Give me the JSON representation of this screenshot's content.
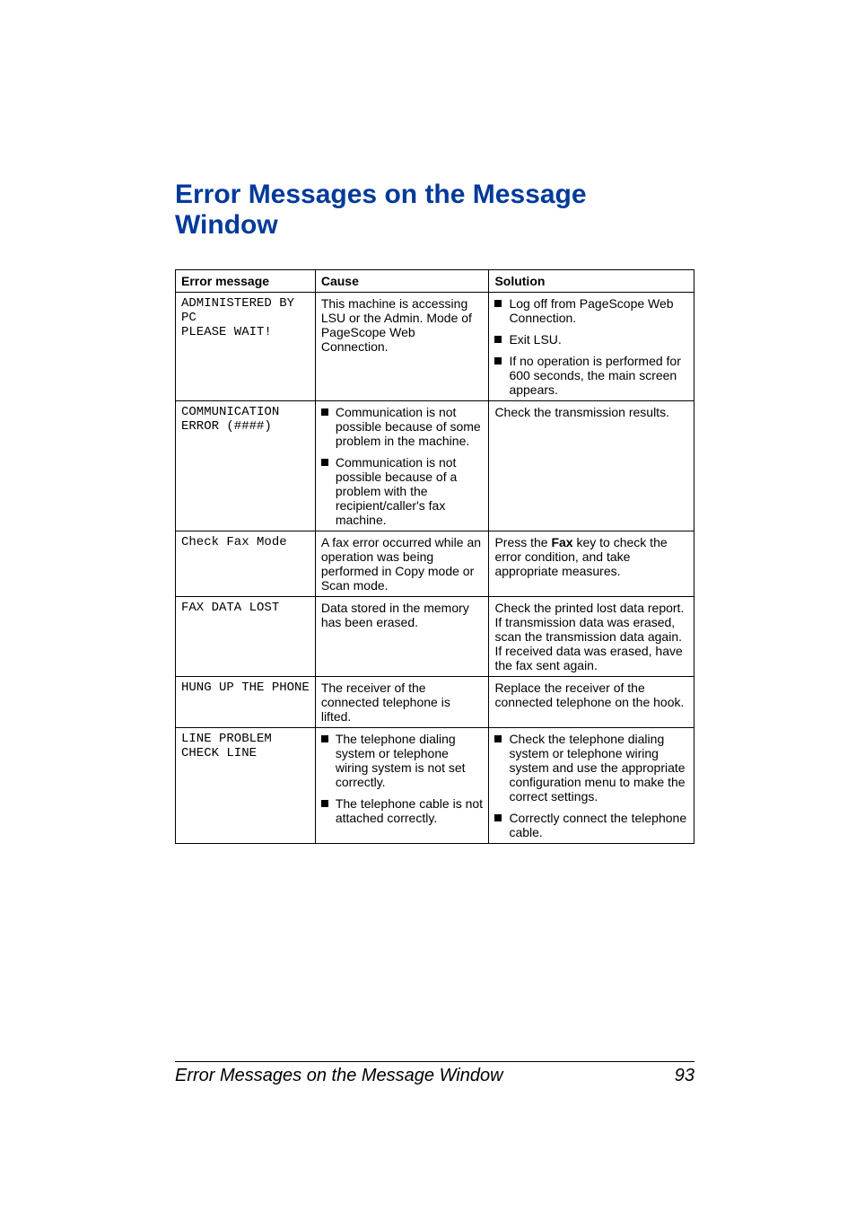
{
  "title": "Error Messages on the Message Window",
  "columns": {
    "c1": "Error message",
    "c2": "Cause",
    "c3": "Solution"
  },
  "rows": {
    "r1": {
      "msg": "ADMINISTERED BY\nPC\nPLEASE WAIT!",
      "cause": "This machine is accessing LSU or the Admin. Mode of PageScope Web Connection.",
      "sol": {
        "b1": "Log off from PageScope Web Connection.",
        "b2": "Exit LSU.",
        "b3": "If no operation is performed for 600 seconds, the main screen appears."
      }
    },
    "r2": {
      "msg": "COMMUNICATION\nERROR (####)",
      "cause": {
        "b1": "Communication is not possible because of some problem in the machine.",
        "b2": "Communication is not possible because of a problem with the recipient/caller's fax machine."
      },
      "sol": "Check the transmission results."
    },
    "r3": {
      "msg": "Check Fax Mode",
      "cause": "A fax error occurred while an operation was being performed in Copy mode or Scan mode.",
      "sol_prefix": "Press the ",
      "sol_bold": "Fax",
      "sol_suffix": " key to check the error condition, and take appropriate measures."
    },
    "r4": {
      "msg": "FAX DATA LOST",
      "cause": "Data stored in the memory has been erased.",
      "sol": "Check the printed lost data report. If transmission data was erased, scan the transmission data again. If received data was erased, have the fax sent again."
    },
    "r5": {
      "msg": "HUNG UP THE PHONE",
      "cause": "The receiver of the connected telephone is lifted.",
      "sol": "Replace the receiver of the connected telephone on the hook."
    },
    "r6": {
      "msg": "LINE PROBLEM\nCHECK LINE",
      "cause": {
        "b1": "The telephone dialing system or telephone wiring system is not set correctly.",
        "b2": "The telephone cable is not attached correctly."
      },
      "sol": {
        "b1": "Check the telephone dialing system or telephone wiring system and use the appropriate configuration menu to make the correct settings.",
        "b2": "Correctly connect the telephone cable."
      }
    }
  },
  "footer": {
    "text": "Error Messages on the Message Window",
    "pagenum": "93"
  }
}
